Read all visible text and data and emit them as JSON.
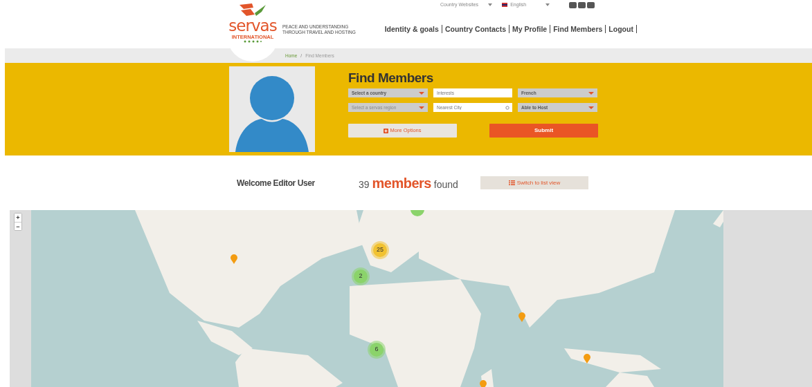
{
  "top_bar": {
    "country_websites": "Country Websites",
    "language": "English"
  },
  "logo": {
    "name": "servas",
    "subtitle": "INTERNATIONAL"
  },
  "tagline": [
    "PEACE AND UNDERSTANDING",
    "THROUGH TRAVEL AND HOSTING"
  ],
  "nav": [
    {
      "label": "Identity & goals",
      "selected": false
    },
    {
      "label": "Country Contacts",
      "selected": false
    },
    {
      "label": "My Profile",
      "selected": false
    },
    {
      "label": "Find Members",
      "selected": false
    },
    {
      "label": "Logout",
      "selected": false
    }
  ],
  "breadcrumb": [
    {
      "label": "Home"
    },
    {
      "label": "Find Members"
    }
  ],
  "breadcrumb_separator": "/",
  "search": {
    "title": "Find Members",
    "fields": [
      {
        "kind": "select",
        "value": "Select a country"
      },
      {
        "kind": "input",
        "placeholder": "Interests"
      },
      {
        "kind": "select",
        "value": "French"
      },
      {
        "kind": "select",
        "placeholder": "Select a servas region"
      },
      {
        "kind": "city",
        "placeholder": "Nearest City"
      },
      {
        "kind": "select",
        "value": "Able to Host"
      }
    ],
    "more_options": "More Options",
    "submit": "Submit"
  },
  "welcome": "Welcome Editor User",
  "results": {
    "count": "39",
    "noun": "members",
    "suffix": "found"
  },
  "switch_view": "Switch to list view",
  "map": {
    "zoom_in": "+",
    "zoom_out": "−",
    "clusters": [
      {
        "count": "25",
        "color": "#f1c232"
      },
      {
        "count": "2",
        "color": "#8bd36b"
      },
      {
        "count": "6",
        "color": "#8bd36b"
      }
    ]
  }
}
